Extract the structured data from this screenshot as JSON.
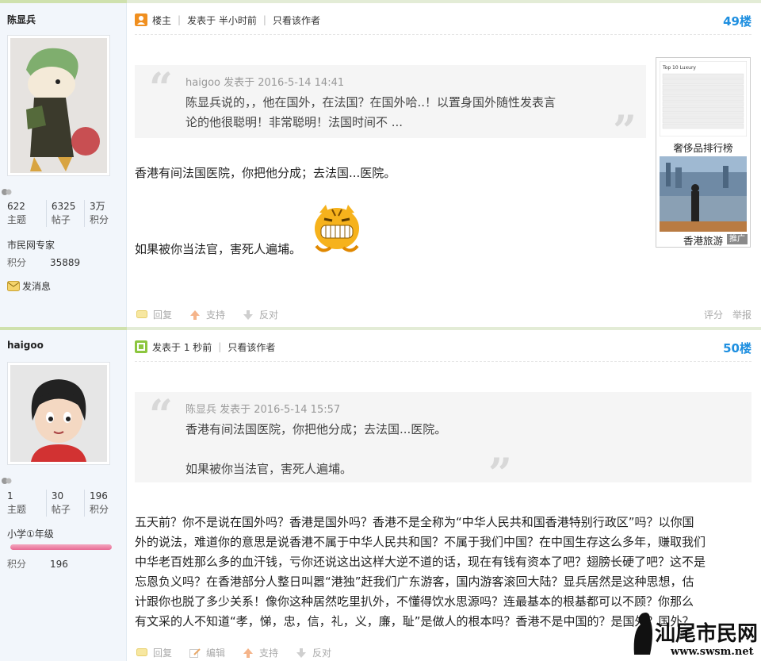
{
  "posts": [
    {
      "author": "陈显兵",
      "stats": [
        {
          "num": "622",
          "label": "主题"
        },
        {
          "num": "6325",
          "label": "帖子"
        },
        {
          "num": "3万",
          "label": "积分"
        }
      ],
      "rank": "市民网专家",
      "score_label": "积分",
      "score_value": "35889",
      "send_msg": "发消息",
      "meta": {
        "role": "楼主",
        "posted": "发表于 半小时前",
        "only_author": "只看该作者"
      },
      "floor": "49楼",
      "quote": {
        "who": "haigoo 发表于 2016-5-14 14:41",
        "lines": [
          "陈显兵说的，，他在国外，在法国？在国外哈..！以置身国外随性发表言",
          "论的他很聪明！非常聪明！法国时间不 ..."
        ]
      },
      "body": [
        "香港有间法国医院，你把他分成；去法国...医院。",
        "如果被你当法官，害死人遍埔。"
      ],
      "ad": {
        "cap1": "奢侈品排行榜",
        "cap2": "香港旅游",
        "tag": "推广",
        "chart_title": "Top 10 Luxury"
      },
      "actions": {
        "reply": "回复",
        "support": "支持",
        "oppose": "反对",
        "rate": "评分",
        "report": "举报"
      }
    },
    {
      "author": "haigoo",
      "stats": [
        {
          "num": "1",
          "label": "主题"
        },
        {
          "num": "30",
          "label": "帖子"
        },
        {
          "num": "196",
          "label": "积分"
        }
      ],
      "rank": "小学①年级",
      "rank_progress": 1.0,
      "score_label": "积分",
      "score_value": "196",
      "meta": {
        "posted": "发表于 1 秒前",
        "only_author": "只看该作者"
      },
      "floor": "50楼",
      "quote": {
        "who": "陈显兵 发表于 2016-5-14 15:57",
        "lines": [
          "香港有间法国医院，你把他分成；去法国...医院。",
          "",
          "如果被你当法官，害死人遍埔。"
        ]
      },
      "body": [
        "五天前？你不是说在国外吗？香港是国外吗？香港不是全称为“中华人民共和国香港特别行政区”吗？以你国",
        "外的说法，难道你的意思是说香港不属于中华人民共和国？不属于我们中国？在中国生存这么多年，赚取我们",
        "中华老百姓那么多的血汗钱，亏你还说这出这样大逆不道的话，现在有钱有资本了吧？翅膀长硬了吧？这不是",
        "忘恩负义吗？在香港部分人整日叫嚣“港独”赶我们广东游客，国内游客滚回大陆？显兵居然是这种思想，估",
        "计跟你也脱了多少关系！像你这种居然吃里扒外，不懂得饮水思源吗？连最基本的根基都可以不顾？你那么",
        "有文采的人不知道“孝，悌，忠，信，礼，义，廉，耻”是做人的根本吗？香港不是中国的？是国外？国外？"
      ],
      "actions": {
        "reply": "回复",
        "edit": "编辑",
        "support": "支持",
        "oppose": "反对"
      }
    }
  ],
  "watermark": {
    "brand": "汕尾市民网",
    "url": "www.swsm.net"
  },
  "colors": {
    "floor": "#1e8fe0",
    "sidebar_bg": "#f2f6fb",
    "quote_bg": "#f5f5f5",
    "rank_bar": "#e86b94"
  }
}
